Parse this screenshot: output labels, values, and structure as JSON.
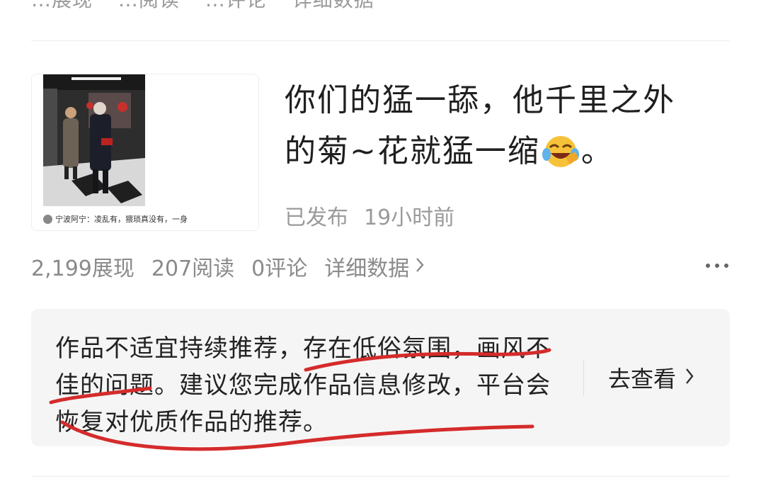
{
  "previous_row": {
    "text": [
      "…展现",
      "…阅读",
      "…评论",
      "详细数据"
    ]
  },
  "post": {
    "thumbnail": {
      "caption_user": "宁波阿宁：",
      "caption_text": "凌乱有，猥琐真没有，一身"
    },
    "title_line1": "你们的猛一舔，他千里之外",
    "title_line2": "的菊~花就猛一缩",
    "title_suffix": "。",
    "status": "已发布",
    "time": "19小时前"
  },
  "stats": {
    "views": "2,199展现",
    "reads": "207阅读",
    "comments": "0评论",
    "detail": "详细数据"
  },
  "notice": {
    "text": "作品不适宜持续推荐，存在低俗氛围，画风不佳的问题。建议您完成作品信息修改，平台会恢复对优质作品的推荐。",
    "action": "去查看"
  },
  "colors": {
    "annotation": "#d52b2b",
    "notice_bg": "#f5f5f5",
    "muted": "#9a9a9a"
  }
}
